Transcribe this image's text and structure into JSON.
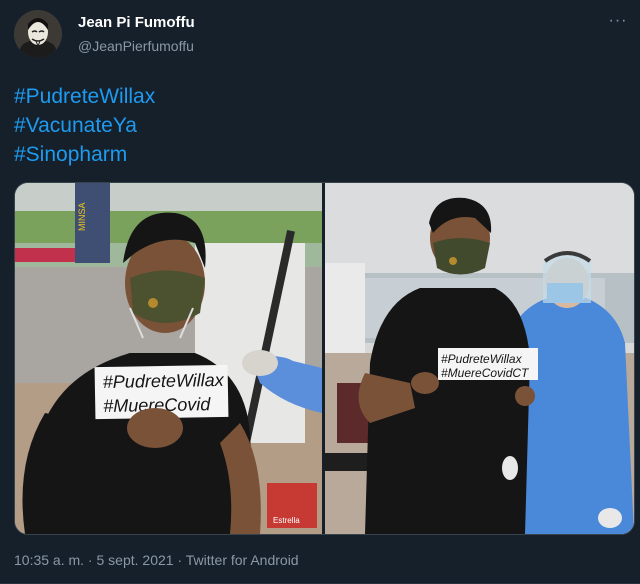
{
  "author": {
    "display_name": "Jean Pi Fumoffu",
    "handle": "@JeanPierfumoffu"
  },
  "menu": {
    "more_glyph": "···"
  },
  "tweet": {
    "hashtags": [
      "#PudreteWillax",
      "#VacunateYa",
      "#Sinopharm"
    ]
  },
  "media": {
    "left_sign": [
      "#PudreteWillax",
      "#MuereCovid"
    ],
    "right_sign": [
      "#PudreteWillax",
      "#MuereCovidCT"
    ],
    "box_text": "Estrella",
    "banner_text": "MINSA"
  },
  "meta": {
    "time": "10:35 a. m.",
    "separator": " · ",
    "date": "5 sept. 2021",
    "source": "Twitter for Android"
  },
  "colors": {
    "background": "#15202b",
    "link": "#1d9bf0",
    "secondary_text": "#8b98a5",
    "primary_text": "#ffffff"
  }
}
